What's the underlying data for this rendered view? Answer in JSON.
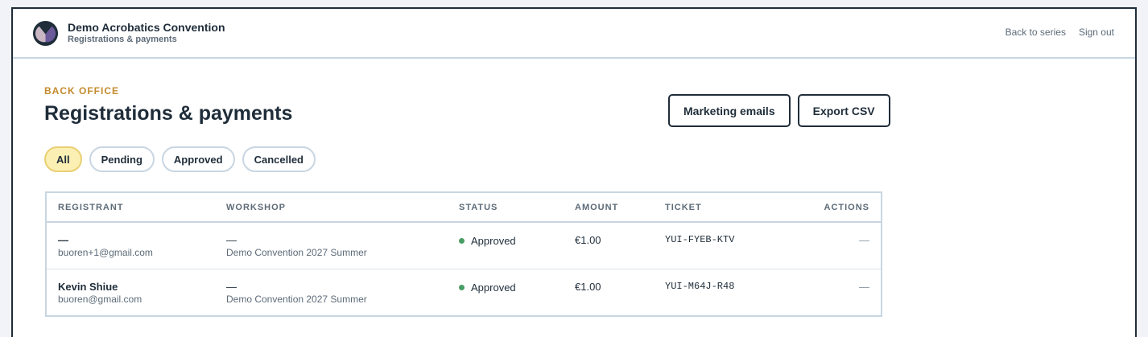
{
  "header": {
    "app_title": "Demo Acrobatics Convention",
    "app_subtitle": "Registrations & payments",
    "links": [
      "Back to series",
      "Sign out"
    ]
  },
  "page": {
    "eyebrow": "BACK OFFICE",
    "title": "Registrations & payments",
    "buttons": {
      "marketing": "Marketing emails",
      "export": "Export CSV"
    }
  },
  "filters": [
    "All",
    "Pending",
    "Approved",
    "Cancelled"
  ],
  "active_filter": "All",
  "table": {
    "columns": [
      "REGISTRANT",
      "WORKSHOP",
      "STATUS",
      "AMOUNT",
      "TICKET",
      "ACTIONS"
    ],
    "rows": [
      {
        "name": "—",
        "email": "buoren+1@gmail.com",
        "workshop": "—",
        "workshop_sub": "Demo Convention 2027 Summer",
        "status": "Approved",
        "amount": "€1.00",
        "ticket": "YUI-FYEB-KTV",
        "actions": "—"
      },
      {
        "name": "Kevin Shiue",
        "email": "buoren@gmail.com",
        "workshop": "—",
        "workshop_sub": "Demo Convention 2027 Summer",
        "status": "Approved",
        "amount": "€1.00",
        "ticket": "YUI-M64J-R48",
        "actions": "—"
      }
    ]
  },
  "colors": {
    "accent": "#c48a2c",
    "active_pill": "#fbefb4",
    "status_approved": "#4a9c65",
    "ink": "#1f2d3a"
  }
}
